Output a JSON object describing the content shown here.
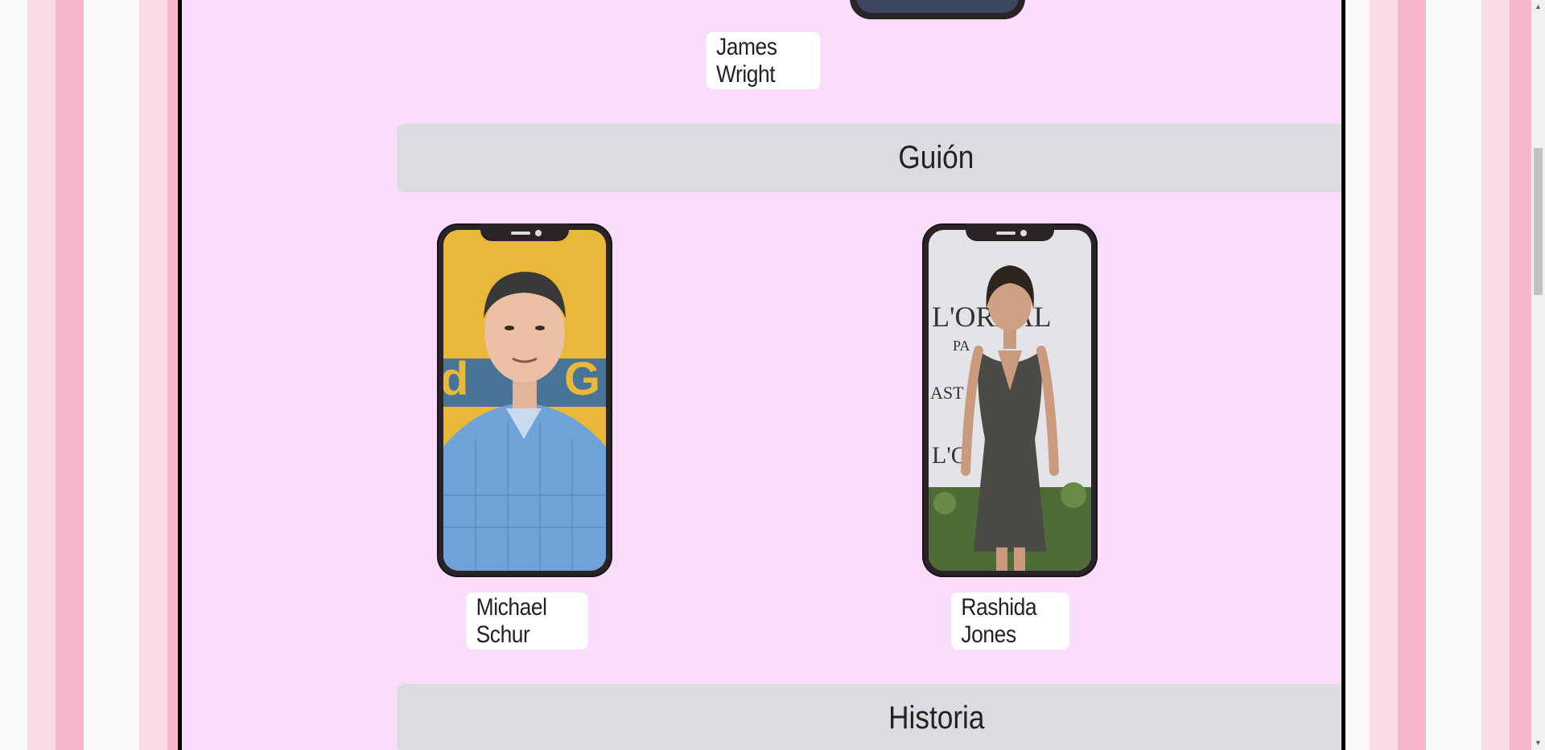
{
  "previous_person": {
    "name": "James Wright"
  },
  "sections": [
    {
      "title": "Guión",
      "people": [
        {
          "name": "Michael Schur",
          "photo": "michael-schur-portrait"
        },
        {
          "name": "Rashida Jones",
          "photo": "rashida-jones-portrait",
          "backdrop_text": [
            "L'ORÉAL",
            "PA",
            "AST",
            "L'O"
          ]
        }
      ]
    },
    {
      "title": "Historia"
    }
  ],
  "colors": {
    "panel_bg": "#fadcfd",
    "section_bar_bg": "#dcdce0",
    "stripe_pink_light": "#fbdbe3",
    "stripe_pink_dark": "#f5b8cb",
    "name_box_bg": "#ffffff",
    "phone_frame": "#2a2328"
  },
  "scrollbar": {
    "up_icon": "chevron-up-icon",
    "down_icon": "chevron-down-icon"
  }
}
